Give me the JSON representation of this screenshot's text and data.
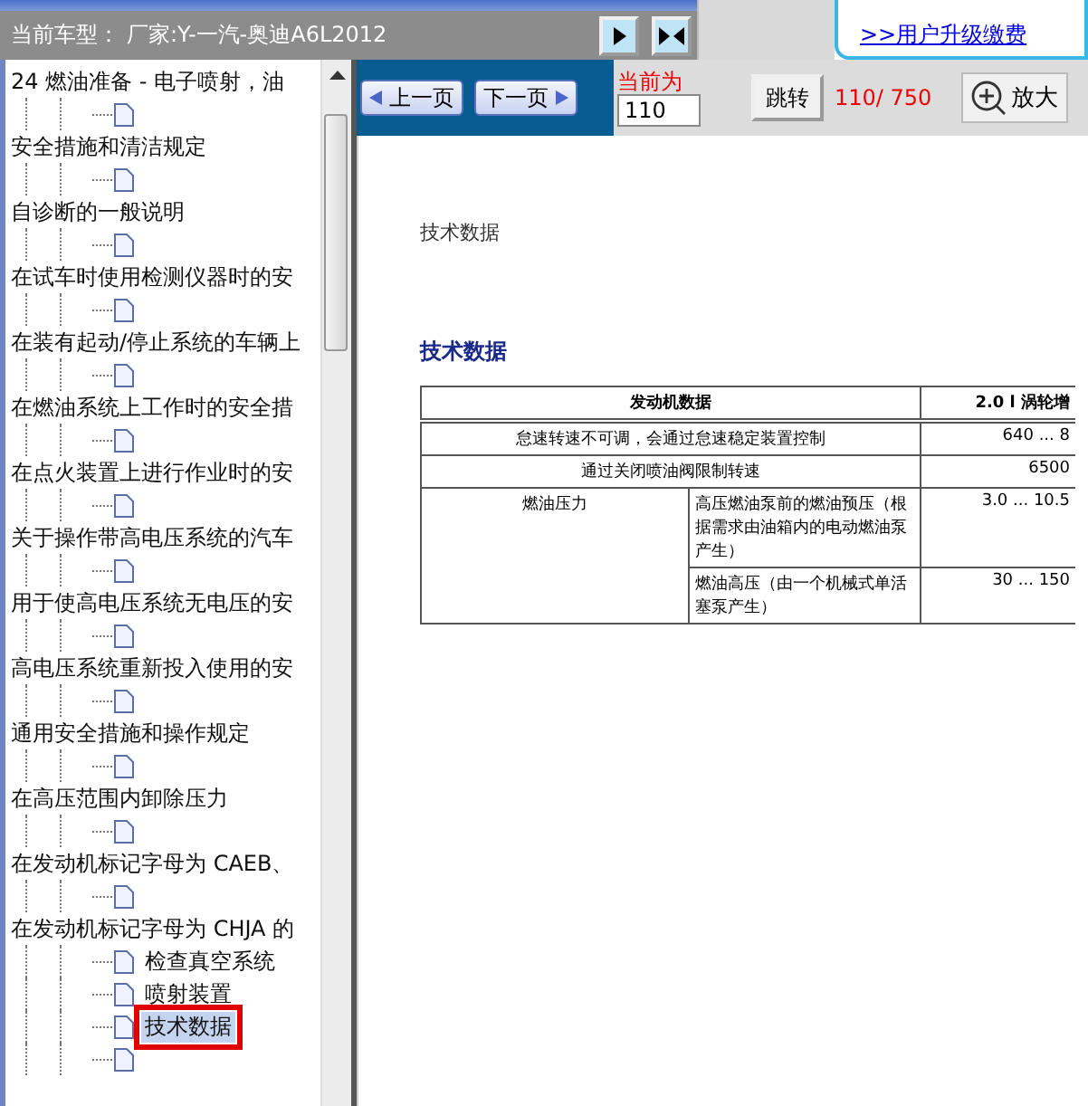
{
  "header": {
    "vehicle_label": "当前车型：",
    "vehicle_value": "厂家:Y-一汽-奥迪A6L2012",
    "upgrade_link": ">>用户升级缴费"
  },
  "tree": [
    {
      "label": "24 燃油准备 - 电子喷射，油",
      "children": [
        {
          "selected": false
        }
      ]
    },
    {
      "label": "安全措施和清洁规定",
      "children": [
        {
          "selected": false
        }
      ]
    },
    {
      "label": "自诊断的一般说明",
      "children": [
        {
          "selected": false
        }
      ]
    },
    {
      "label": "在试车时使用检测仪器时的安",
      "children": [
        {
          "selected": false
        }
      ]
    },
    {
      "label": "在装有起动/停止系统的车辆上",
      "children": [
        {
          "selected": false
        }
      ]
    },
    {
      "label": "在燃油系统上工作时的安全措",
      "children": [
        {
          "selected": false
        }
      ]
    },
    {
      "label": "在点火装置上进行作业时的安",
      "children": [
        {
          "selected": false
        }
      ]
    },
    {
      "label": "关于操作带高电压系统的汽车",
      "children": [
        {
          "selected": false
        }
      ]
    },
    {
      "label": "用于使高电压系统无电压的安",
      "children": [
        {
          "selected": false
        }
      ]
    },
    {
      "label": "高电压系统重新投入使用的安",
      "children": [
        {
          "selected": false
        }
      ]
    },
    {
      "label": "通用安全措施和操作规定",
      "children": [
        {
          "selected": false
        }
      ]
    },
    {
      "label": "在高压范围内卸除压力",
      "children": [
        {
          "selected": false
        }
      ]
    },
    {
      "label": "在发动机标记字母为 CAEB、",
      "children": [
        {
          "selected": false
        }
      ]
    },
    {
      "label": "在发动机标记字母为 CHJA 的",
      "children": [
        {
          "label": "检查真空系统",
          "selected": false
        },
        {
          "label": "喷射装置",
          "selected": false
        },
        {
          "label": "技术数据",
          "selected": true
        },
        {
          "selected": false
        }
      ]
    }
  ],
  "toolbar": {
    "prev": "上一页",
    "next": "下一页",
    "current_label": "当前为",
    "page_input": "110",
    "jump": "跳转",
    "page_count": "110/ 750",
    "zoom": "放大"
  },
  "document": {
    "running_head": "技术数据",
    "heading": "技术数据",
    "table": {
      "columns": [
        "发动机数据",
        "2.0 l 涡轮增"
      ],
      "rows": [
        {
          "cells": [
            "怠速转速不可调，会通过怠速稳定装置控制",
            "640 ... 8"
          ]
        },
        {
          "cells": [
            "通过关闭喷油阀限制转速",
            "6500"
          ]
        },
        {
          "group": "燃油压力",
          "sub": [
            {
              "cells": [
                "高压燃油泵前的燃油预压（根据需求由油箱内的电动燃油泵产生）",
                "3.0 ... 10.5"
              ]
            },
            {
              "cells": [
                "燃油高压（由一个机械式单活塞泵产生）",
                "30 ... 150"
              ]
            }
          ]
        }
      ]
    }
  }
}
